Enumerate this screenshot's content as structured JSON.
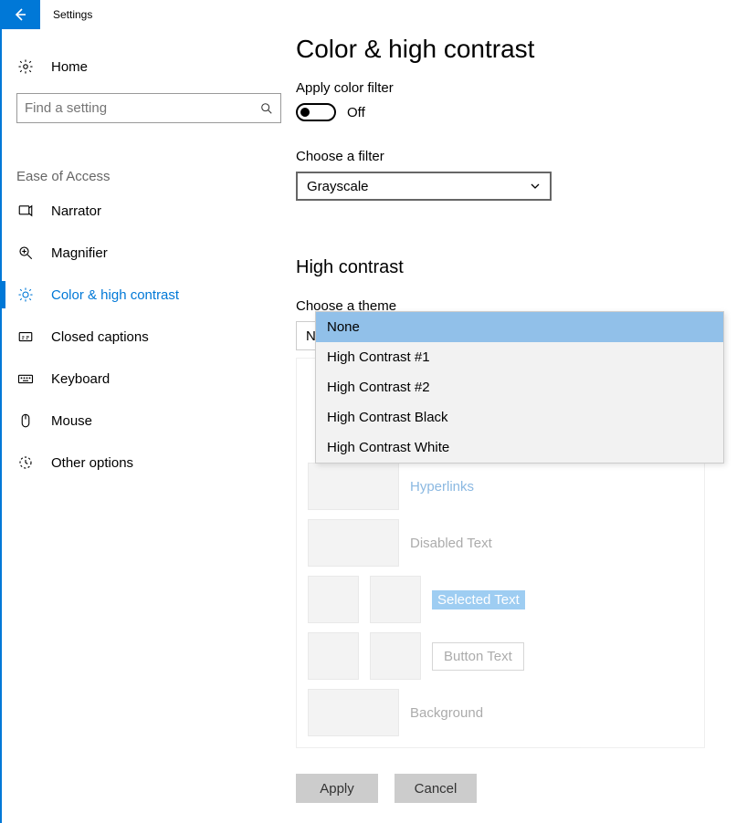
{
  "app_title": "Settings",
  "home_label": "Home",
  "search_placeholder": "Find a setting",
  "category_label": "Ease of Access",
  "nav": {
    "narrator": "Narrator",
    "magnifier": "Magnifier",
    "color": "Color & high contrast",
    "captions": "Closed captions",
    "keyboard": "Keyboard",
    "mouse": "Mouse",
    "other": "Other options"
  },
  "page_title": "Color & high contrast",
  "apply_filter_label": "Apply color filter",
  "toggle_state": "Off",
  "choose_filter_label": "Choose a filter",
  "filter_value": "Grayscale",
  "section_high_contrast": "High contrast",
  "choose_theme_label": "Choose a theme",
  "theme_options": {
    "none": "None",
    "hc1": "High Contrast #1",
    "hc2": "High Contrast #2",
    "hcblack": "High Contrast Black",
    "hcwhite": "High Contrast White"
  },
  "preview": {
    "hyperlinks": "Hyperlinks",
    "disabled": "Disabled Text",
    "selected": "Selected Text",
    "button": "Button Text",
    "background": "Background"
  },
  "apply_btn": "Apply",
  "cancel_btn": "Cancel"
}
